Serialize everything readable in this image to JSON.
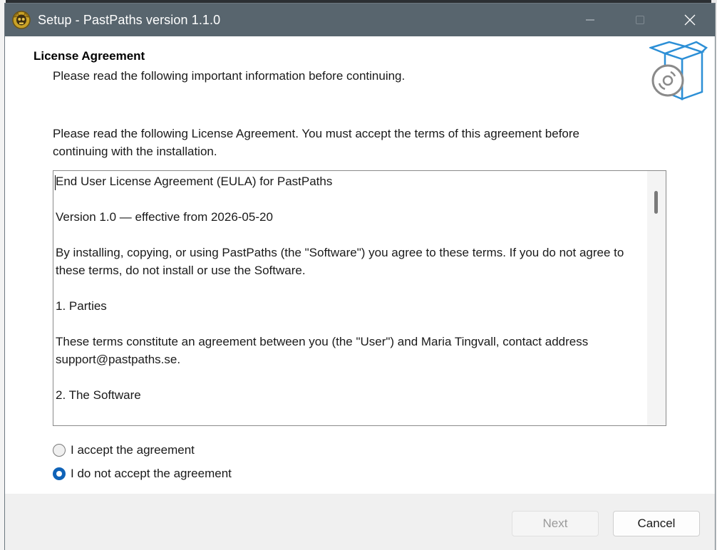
{
  "window": {
    "title": "Setup - PastPaths version 1.1.0",
    "app_icon": "skull-logo-icon",
    "controls": [
      "minimize-icon",
      "maximize-icon",
      "close-icon"
    ]
  },
  "header": {
    "title": "License Agreement",
    "subtitle": "Please read the following important information before continuing.",
    "icon": "setup-box-disc-icon"
  },
  "instructions": "Please read the following License Agreement. You must accept the terms of this agreement before continuing with the installation.",
  "license": {
    "paragraphs": [
      "End User License Agreement (EULA) for PastPaths",
      "Version 1.0 — effective from 2026-05-20",
      "By installing, copying, or using PastPaths (the \"Software\") you agree to these terms. If you do not agree to these terms, do not install or use the Software.",
      "1. Parties",
      "These terms constitute an agreement between you (the \"User\") and Maria Tingvall, contact address support@pastpaths.se.",
      "2. The Software"
    ]
  },
  "options": {
    "accept_label": "I accept the agreement",
    "decline_label": "I do not accept the agreement",
    "selected": "decline"
  },
  "buttons": {
    "next_label": "Next",
    "next_enabled": false,
    "cancel_label": "Cancel"
  },
  "colors": {
    "titlebar": "#58656e",
    "accent": "#0f63b8",
    "footer": "#f0f0f0"
  }
}
